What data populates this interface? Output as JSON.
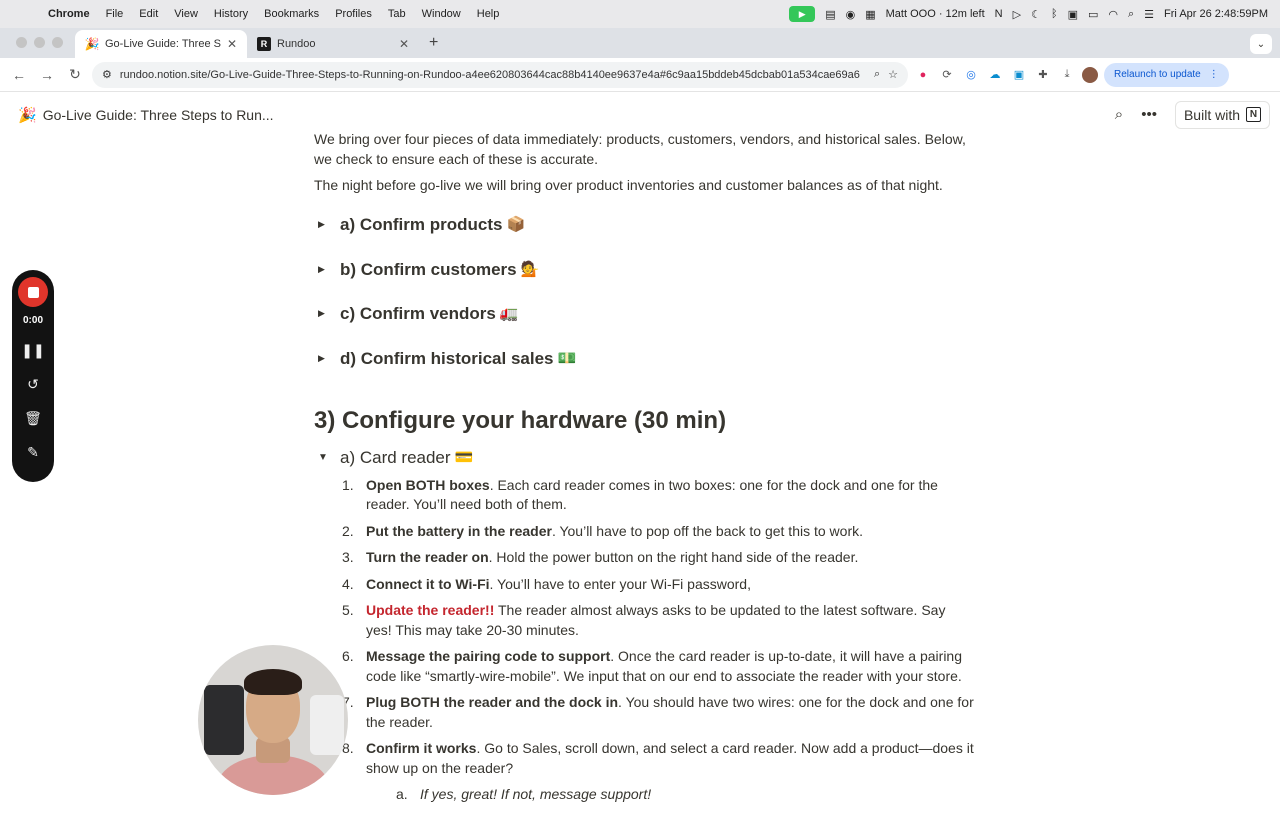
{
  "menubar": {
    "app": "Chrome",
    "items": [
      "File",
      "Edit",
      "View",
      "History",
      "Bookmarks",
      "Profiles",
      "Tab",
      "Window",
      "Help"
    ],
    "status": "Matt OOO · 12m left",
    "datetime": "Fri Apr 26  2:48:59PM"
  },
  "tabs": [
    {
      "title": "Go-Live Guide: Three Steps t",
      "favicon": "🎉"
    },
    {
      "title": "Rundoo",
      "favicon": "R"
    }
  ],
  "address": {
    "url": "rundoo.notion.site/Go-Live-Guide-Three-Steps-to-Running-on-Rundoo-a4ee620803644cac88b4140ee9637e4a#6c9aa15bddeb45dcbab01a534cae69a6",
    "relaunch": "Relaunch to update"
  },
  "notion": {
    "page_emoji": "🎉",
    "page_title": "Go-Live Guide: Three Steps to Run...",
    "built_with": "Built with"
  },
  "content": {
    "p1": "We bring over four pieces of data immediately: products, customers, vendors, and historical sales. Below, we check to ensure each of these is accurate.",
    "p2": "The night before go-live we will bring over product inventories and customer balances as of that night.",
    "toggles": [
      {
        "label": "a) Confirm products",
        "emoji": "📦"
      },
      {
        "label": "b) Confirm customers",
        "emoji": "💁"
      },
      {
        "label": "c) Confirm vendors",
        "emoji": "🚛"
      },
      {
        "label": "d) Confirm historical sales",
        "emoji": "💵"
      }
    ],
    "heading": "3) Configure your hardware (30 min)",
    "subtoggle": {
      "label": "a) Card reader",
      "emoji": "💳"
    },
    "steps": [
      {
        "num": "1.",
        "bold": "Open BOTH boxes",
        "text": ". Each card reader comes in two boxes: one for the dock and one for the reader. You’ll need both of them."
      },
      {
        "num": "2.",
        "bold": "Put the battery in the reader",
        "text": ". You’ll have to pop off the back to get this to work."
      },
      {
        "num": "3.",
        "bold": "Turn the reader on",
        "text": ". Hold the power button on the right hand side of the reader."
      },
      {
        "num": "4.",
        "bold": "Connect it to Wi-Fi",
        "text": ". You’ll have to enter your Wi-Fi password,"
      },
      {
        "num": "5.",
        "red": "Update the reader!!",
        "text": " The reader almost always asks to be updated to the latest software. Say yes! This may take 20-30 minutes."
      },
      {
        "num": "6.",
        "bold": "Message the pairing code to support",
        "text": ". Once the card reader is up-to-date, it will have a pairing code like “smartly-wire-mobile”. We input that on our end to associate the reader with your store."
      },
      {
        "num": "7.",
        "bold": "Plug BOTH the reader and the dock in",
        "text": ". You should have two wires: one for the dock and one for the reader."
      },
      {
        "num": "8.",
        "bold": "Confirm it works",
        "text": ". Go to Sales, scroll down, and select a card reader. Now add a product—does it show up on the reader?"
      }
    ],
    "substep": {
      "num": "a.",
      "text": "If yes, great! If not, message support!"
    }
  },
  "recorder": {
    "time": "0:00"
  },
  "colors": {
    "accent_red": "#c4262e",
    "record_red": "#e0352b",
    "text": "#37352f"
  }
}
